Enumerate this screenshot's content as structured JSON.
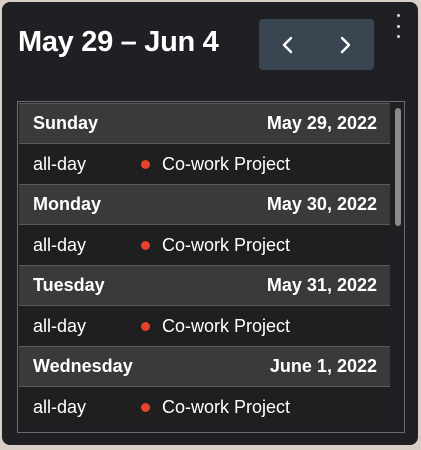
{
  "header": {
    "range_title": "May 29 – Jun 4",
    "prev_icon": "chevron-left-icon",
    "next_icon": "chevron-right-icon",
    "menu_icon": "kebab-menu-icon"
  },
  "colors": {
    "widget_bg": "#1f2023",
    "nav_bg": "#3a4552",
    "day_header_bg": "#3a3a3a",
    "event_dot": "#e8412c"
  },
  "days": [
    {
      "name": "Sunday",
      "date": "May 29, 2022",
      "event": {
        "time": "all-day",
        "title": "Co-work Project"
      }
    },
    {
      "name": "Monday",
      "date": "May 30, 2022",
      "event": {
        "time": "all-day",
        "title": "Co-work Project"
      }
    },
    {
      "name": "Tuesday",
      "date": "May 31, 2022",
      "event": {
        "time": "all-day",
        "title": "Co-work Project"
      }
    },
    {
      "name": "Wednesday",
      "date": "June 1, 2022",
      "event": {
        "time": "all-day",
        "title": "Co-work Project"
      }
    }
  ]
}
